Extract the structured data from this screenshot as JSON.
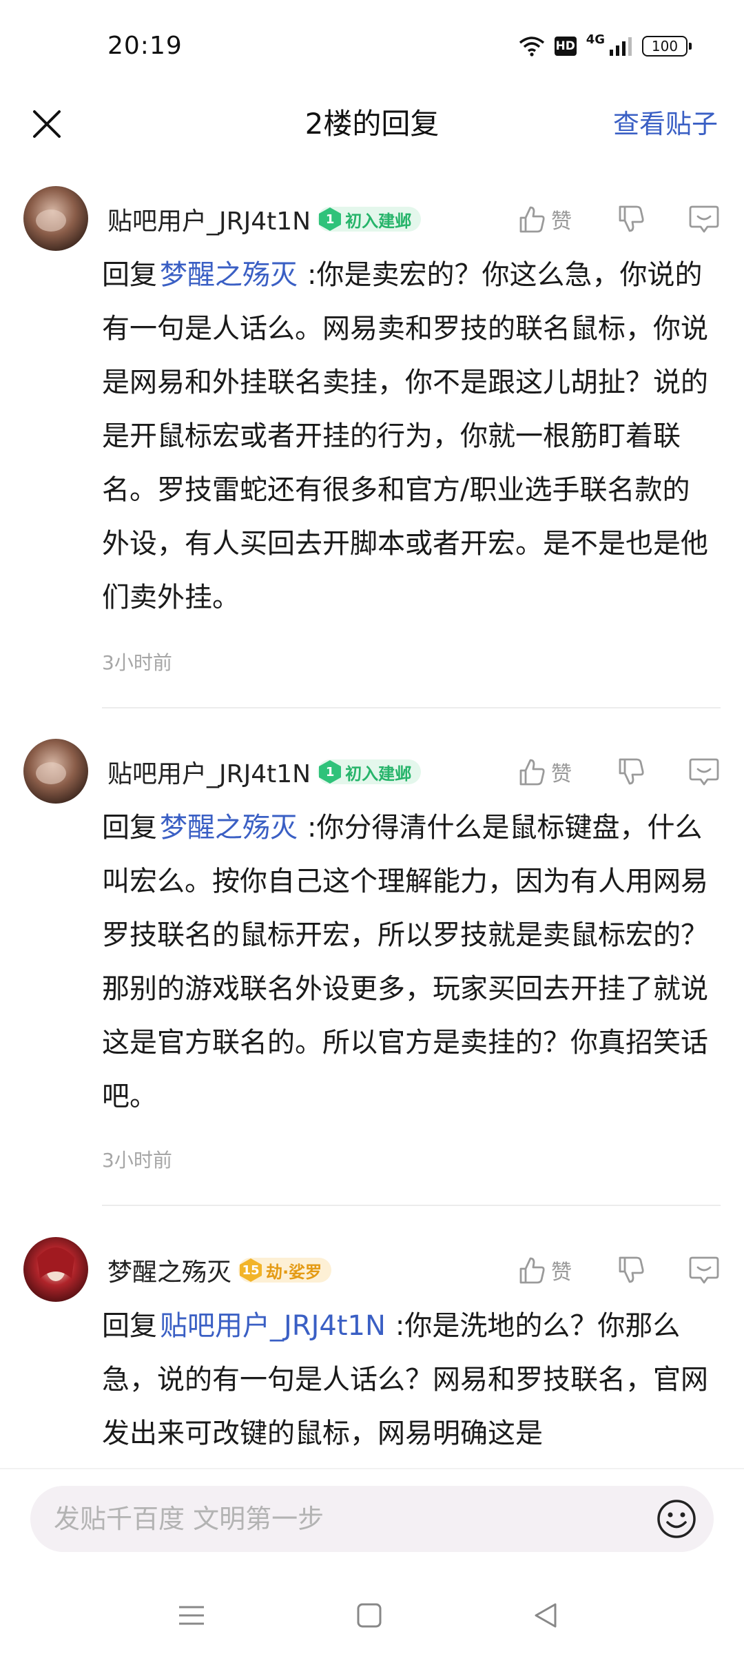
{
  "status_bar": {
    "time": "20:19",
    "hd": "HD",
    "network": "4G",
    "battery": "100"
  },
  "header": {
    "close_icon": "close-icon",
    "title": "2楼的回复",
    "view_post": "查看贴子"
  },
  "replies": [
    {
      "username": "贴吧用户_JRJ4t1N",
      "level": "1",
      "level_name": "初入建邺",
      "like_label": "赞",
      "reply_prefix": "回复",
      "mention": "梦醒之殇灭",
      "text": ":你是卖宏的？你这么急，你说的有一句是人话么。网易卖和罗技的联名鼠标，你说是网易和外挂联名卖挂，你不是跟这儿胡扯？说的是开鼠标宏或者开挂的行为，你就一根筋盯着联名。罗技雷蛇还有很多和官方/职业选手联名款的外设，有人买回去开脚本或者开宏。是不是也是他们卖外挂。",
      "time": "3小时前",
      "badge_color": "#2fc27a"
    },
    {
      "username": "贴吧用户_JRJ4t1N",
      "level": "1",
      "level_name": "初入建邺",
      "like_label": "赞",
      "reply_prefix": "回复",
      "mention": "梦醒之殇灭",
      "text": ":你分得清什么是鼠标键盘，什么叫宏么。按你自己这个理解能力，因为有人用网易罗技联名的鼠标开宏，所以罗技就是卖鼠标宏的？那别的游戏联名外设更多，玩家买回去开挂了就说这是官方联名的。所以官方是卖挂的？你真招笑话吧。",
      "time": "3小时前",
      "badge_color": "#2fc27a"
    },
    {
      "username": "梦醒之殇灭",
      "level": "15",
      "level_name": "劫·娑罗",
      "like_label": "赞",
      "reply_prefix": "回复",
      "mention": "贴吧用户_JRJ4t1N",
      "text": ":你是洗地的么？你那么急，说的有一句是人话么？网易和罗技联名，官网发出来可改键的鼠标，网易明确这是",
      "badge_color": "#f2b428"
    }
  ],
  "input": {
    "placeholder": "发贴千百度 文明第一步",
    "emoji_icon": "emoji-icon"
  },
  "nav": {
    "menu_icon": "menu-icon",
    "home_icon": "home-icon",
    "back_icon": "back-icon"
  }
}
